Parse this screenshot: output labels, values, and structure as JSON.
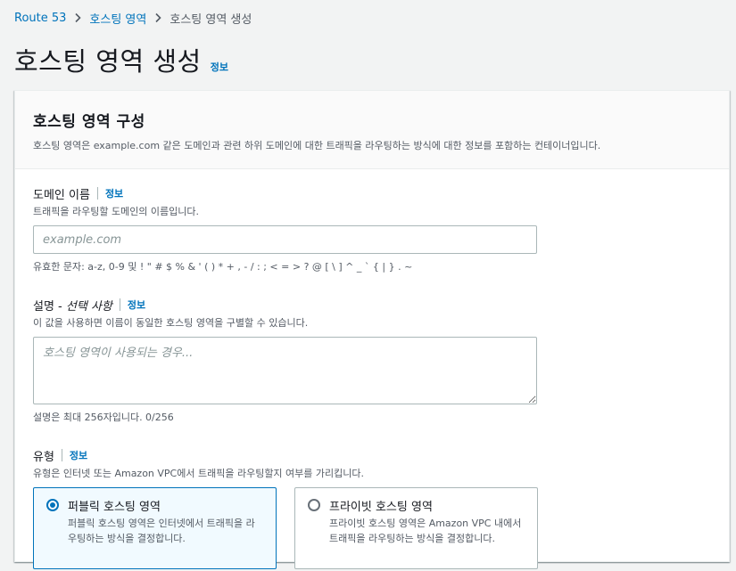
{
  "breadcrumb": {
    "root": "Route 53",
    "parent": "호스팅 영역",
    "current": "호스팅 영역 생성"
  },
  "page": {
    "title": "호스팅 영역 생성",
    "info": "정보"
  },
  "panel": {
    "title": "호스팅 영역 구성",
    "description": "호스팅 영역은 example.com 같은 도메인과 관련 하위 도메인에 대한 트래픽을 라우팅하는 방식에 대한 정보를 포함하는 컨테이너입니다."
  },
  "domain_field": {
    "label": "도메인 이름",
    "info": "정보",
    "description": "트래픽을 라우팅할 도메인의 이름입니다.",
    "placeholder": "example.com",
    "value": "",
    "constraint": "유효한 문자: a-z, 0-9 및 ! \" # $ % & ' ( ) * + , - / : ; < = > ? @ [ \\ ] ^ _ ` { | } . ~"
  },
  "description_field": {
    "label": "설명 - ",
    "label_optional": "선택 사항",
    "info": "정보",
    "description": "이 값을 사용하면 이름이 동일한 호스팅 영역을 구별할 수 있습니다.",
    "placeholder": "호스팅 영역이 사용되는 경우...",
    "value": "",
    "constraint": "설명은 최대 256자입니다. 0/256"
  },
  "type_field": {
    "label": "유형",
    "info": "정보",
    "description": "유형은 인터넷 또는 Amazon VPC에서 트래픽을 라우팅할지 여부를 가리킵니다.",
    "options": [
      {
        "title": "퍼블릭 호스팅 영역",
        "description": "퍼블릭 호스팅 영역은 인터넷에서 트래픽을 라우팅하는 방식을 결정합니다.",
        "selected": true
      },
      {
        "title": "프라이빗 호스팅 영역",
        "description": "프라이빗 호스팅 영역은 Amazon VPC 내에서 트래픽을 라우팅하는 방식을 결정합니다.",
        "selected": false
      }
    ]
  },
  "icons": {
    "breadcrumb_separator": "chevron-right-icon"
  },
  "colors": {
    "link": "#0073bb",
    "selected_tile_bg": "#f1faff",
    "page_bg": "#f2f3f3"
  }
}
